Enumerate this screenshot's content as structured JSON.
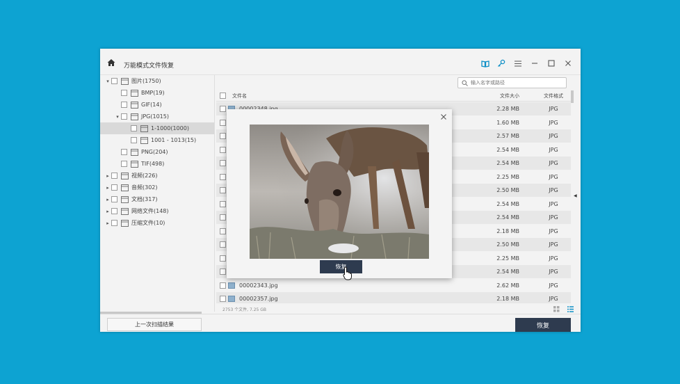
{
  "window": {
    "title": "万能模式文件恢复"
  },
  "search": {
    "placeholder": "输入名字或路径"
  },
  "tree": [
    {
      "label": "图片(1750)",
      "depth": 0,
      "caret": "▾"
    },
    {
      "label": "BMP(19)",
      "depth": 1,
      "caret": ""
    },
    {
      "label": "GIF(14)",
      "depth": 1,
      "caret": ""
    },
    {
      "label": "JPG(1015)",
      "depth": 1,
      "caret": "▾"
    },
    {
      "label": "1-1000(1000)",
      "depth": 2,
      "caret": "",
      "selected": true
    },
    {
      "label": "1001 -  1013(15)",
      "depth": 2,
      "caret": ""
    },
    {
      "label": "PNG(204)",
      "depth": 1,
      "caret": ""
    },
    {
      "label": "TIF(498)",
      "depth": 1,
      "caret": ""
    },
    {
      "label": "视频(226)",
      "depth": 0,
      "caret": "▸"
    },
    {
      "label": "音频(302)",
      "depth": 0,
      "caret": "▸"
    },
    {
      "label": "文档(317)",
      "depth": 0,
      "caret": "▸"
    },
    {
      "label": "网络文件(148)",
      "depth": 0,
      "caret": "▸"
    },
    {
      "label": "压缩文件(10)",
      "depth": 0,
      "caret": "▸"
    }
  ],
  "list": {
    "headers": {
      "name": "文件名",
      "size": "文件大小",
      "type": "文件格式"
    },
    "rows": [
      {
        "name": "00002348.jpg",
        "size": "2.28 MB",
        "type": "JPG"
      },
      {
        "name": "",
        "size": "1.60 MB",
        "type": "JPG"
      },
      {
        "name": "",
        "size": "2.57 MB",
        "type": "JPG"
      },
      {
        "name": "",
        "size": "2.54 MB",
        "type": "JPG"
      },
      {
        "name": "",
        "size": "2.54 MB",
        "type": "JPG"
      },
      {
        "name": "",
        "size": "2.25 MB",
        "type": "JPG"
      },
      {
        "name": "",
        "size": "2.50 MB",
        "type": "JPG"
      },
      {
        "name": "",
        "size": "2.54 MB",
        "type": "JPG"
      },
      {
        "name": "",
        "size": "2.54 MB",
        "type": "JPG"
      },
      {
        "name": "",
        "size": "2.18 MB",
        "type": "JPG"
      },
      {
        "name": "",
        "size": "2.50 MB",
        "type": "JPG"
      },
      {
        "name": "",
        "size": "2.25 MB",
        "type": "JPG"
      },
      {
        "name": "",
        "size": "2.54 MB",
        "type": "JPG"
      },
      {
        "name": "00002343.jpg",
        "size": "2.62 MB",
        "type": "JPG"
      },
      {
        "name": "00002357.jpg",
        "size": "2.18 MB",
        "type": "JPG"
      }
    ]
  },
  "status": {
    "summary": "2753 个文件, 7.25 GB"
  },
  "bottom": {
    "last_scan_label": "上一次扫描结果",
    "recover_label": "恢复"
  },
  "dialog": {
    "recover_label": "恢复"
  },
  "colors": {
    "accent": "#0da3d2",
    "dark_button": "#2e3b4f",
    "background": "#0da3d2"
  }
}
